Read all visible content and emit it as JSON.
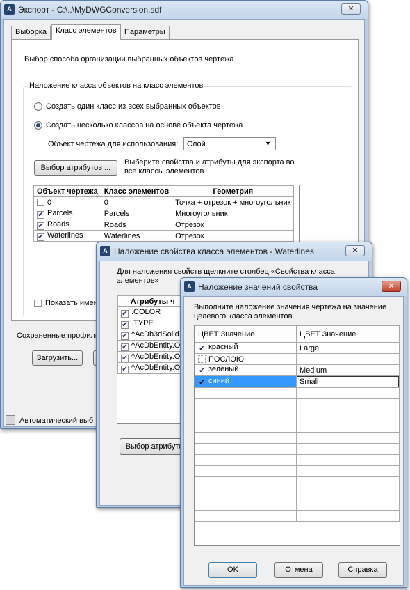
{
  "export_window": {
    "title": "Экспорт - C:\\..\\MyDWGConversion.sdf",
    "close": "✕",
    "tabs": [
      "Выборка",
      "Класс элементов",
      "Параметры"
    ],
    "description": "Выбор способа организации выбранных объектов чертежа",
    "group_title": "Наложение класса объектов на класс элементов",
    "radio_single": "Создать один класс из всех выбранных объектов",
    "radio_multiple": "Создать несколько классов на основе объекта чертежа",
    "object_to_use_label": "Объект чертежа для использования:",
    "object_to_use_value": "Слой",
    "select_attributes_button": "Выбор атрибутов ...",
    "select_attributes_hint": "Выберите свойства и атрибуты для экспорта во все классы элементов",
    "table_headers": [
      "Объект чертежа",
      "Класс элементов",
      "Геометрия"
    ],
    "table_rows": [
      {
        "checked": false,
        "object": "0",
        "class": "0",
        "geometry": "Точка + отрезок + многоугольник"
      },
      {
        "checked": true,
        "object": "Parcels",
        "class": "Parcels",
        "geometry": "Многоугольник"
      },
      {
        "checked": true,
        "object": "Roads",
        "class": "Roads",
        "geometry": "Отрезок"
      },
      {
        "checked": true,
        "object": "Waterlines",
        "class": "Waterlines",
        "geometry": "Отрезок"
      }
    ],
    "show_names_label": "Показать имена",
    "saved_profiles_label": "Сохраненные профили",
    "load_button": "Загрузить...",
    "status_text": "Автоматический выб"
  },
  "mapping_window": {
    "title": "Наложение свойства класса элементов - Waterlines",
    "close": "✕",
    "instruction": "Для наложения свойств щелкните столбец «Свойства класса элементов»",
    "column_header": "Атрибуты ч",
    "attributes": [
      ".COLOR",
      ".TYPE",
      "^AcDb3dSolid.I",
      "^AcDbEntity.Ob",
      "^AcDbEntity.Ob",
      "^AcDbEntity.Ob"
    ],
    "select_attributes_button": "Выбор атрибуто"
  },
  "value_window": {
    "title": "Наложение значений свойства",
    "close": "✕",
    "instruction": "Выполните наложение значения чертежа на значение целевого класса элементов",
    "column_headers": [
      "ЦВЕТ Значение",
      "ЦВЕТ Значение"
    ],
    "rows": [
      {
        "checked": true,
        "source": "красный",
        "target": "Large"
      },
      {
        "checked": false,
        "source": "ПОСЛОЮ",
        "target": ""
      },
      {
        "checked": true,
        "source": "зеленый",
        "target": "Medium"
      },
      {
        "checked": true,
        "source": "синий",
        "target": "Small"
      }
    ],
    "ok_button": "OK",
    "cancel_button": "Отмена",
    "help_button": "Справка"
  },
  "colors": {
    "title_bar": "#c2d5ea",
    "selection": "#3399ff",
    "close_red": "#c4412a"
  }
}
